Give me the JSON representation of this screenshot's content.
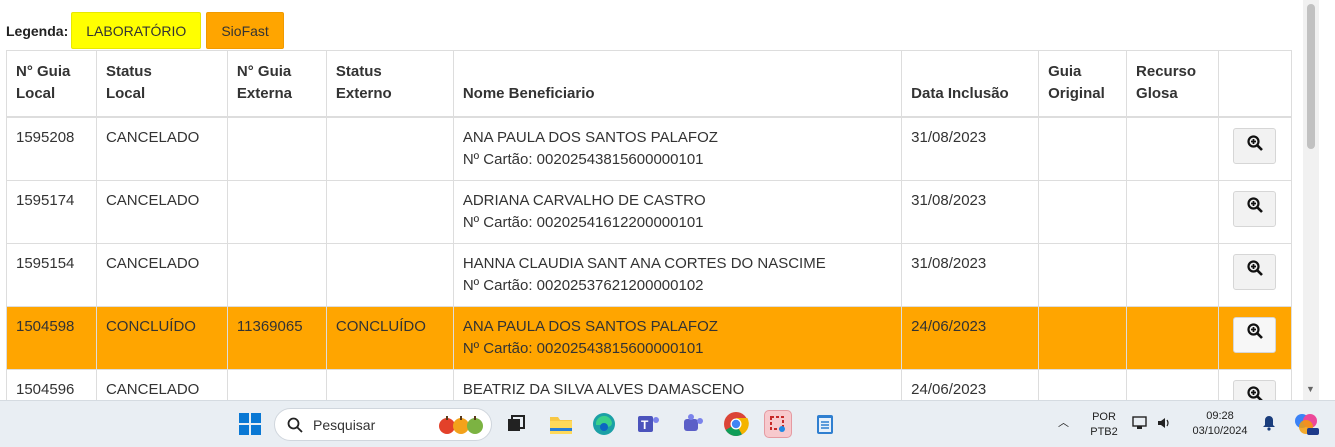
{
  "legend": {
    "label": "Legenda:",
    "chips": [
      {
        "label": "LABORATÓRIO",
        "color": "#ffff00"
      },
      {
        "label": "SioFast",
        "color": "#ffa500"
      }
    ]
  },
  "table": {
    "headers": [
      [
        "N° Guia",
        "Local"
      ],
      [
        "Status",
        "Local"
      ],
      [
        "N° Guia",
        "Externa"
      ],
      [
        "Status",
        "Externo"
      ],
      [
        "",
        "Nome Beneficiario"
      ],
      [
        "",
        "Data Inclusão"
      ],
      [
        "Guia",
        "Original"
      ],
      [
        "Recurso",
        "Glosa"
      ],
      [
        "",
        ""
      ]
    ],
    "rows": [
      {
        "guia_local": "1595208",
        "status_local": "CANCELADO",
        "guia_externa": "",
        "status_externo": "",
        "nome": "ANA PAULA DOS SANTOS PALAFOZ",
        "cartao": "Nº Cartão: 00202543815600000101",
        "data": "31/08/2023",
        "guia_original": "",
        "recurso_glosa": "",
        "highlight": "none"
      },
      {
        "guia_local": "1595174",
        "status_local": "CANCELADO",
        "guia_externa": "",
        "status_externo": "",
        "nome": "ADRIANA CARVALHO DE CASTRO",
        "cartao": "Nº Cartão: 00202541612200000101",
        "data": "31/08/2023",
        "guia_original": "",
        "recurso_glosa": "",
        "highlight": "none"
      },
      {
        "guia_local": "1595154",
        "status_local": "CANCELADO",
        "guia_externa": "",
        "status_externo": "",
        "nome": "HANNA CLAUDIA SANT ANA CORTES DO NASCIME",
        "cartao": "Nº Cartão: 00202537621200000102",
        "data": "31/08/2023",
        "guia_original": "",
        "recurso_glosa": "",
        "highlight": "none"
      },
      {
        "guia_local": "1504598",
        "status_local": "CONCLUÍDO",
        "guia_externa": "11369065",
        "status_externo": "CONCLUÍDO",
        "nome": "ANA PAULA DOS SANTOS PALAFOZ",
        "cartao": "Nº Cartão: 00202543815600000101",
        "data": "24/06/2023",
        "guia_original": "",
        "recurso_glosa": "",
        "highlight": "siofast"
      },
      {
        "guia_local": "1504596",
        "status_local": "CANCELADO",
        "guia_externa": "",
        "status_externo": "",
        "nome": "BEATRIZ DA SILVA ALVES DAMASCENO",
        "cartao": "",
        "data": "24/06/2023",
        "guia_original": "",
        "recurso_glosa": "",
        "highlight": "none"
      }
    ],
    "view_icon": "zoom-in-icon"
  },
  "taskbar": {
    "search_placeholder": "Pesquisar",
    "apps": [
      "windows-start-icon",
      "file-explorer-icon",
      "edge-icon",
      "teams-icon",
      "chrome-icon",
      "snipping-icon",
      "notepad-icon"
    ],
    "lang_top": "POR",
    "lang_bottom": "PTB2",
    "time": "09:28",
    "date": "03/10/2024"
  }
}
